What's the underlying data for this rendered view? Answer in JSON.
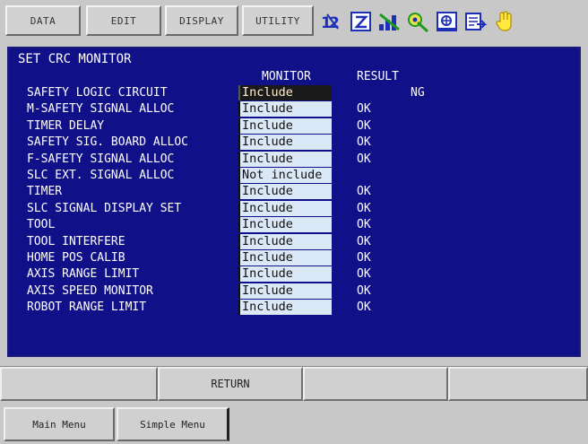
{
  "menubar": {
    "items": [
      "DATA",
      "EDIT",
      "DISPLAY",
      "UTILITY"
    ]
  },
  "icons": [
    "toggle-12-icon",
    "z-icon",
    "signal-icon",
    "tool-icon",
    "monitor-icon",
    "document-arrow-icon",
    "hand-icon"
  ],
  "panel": {
    "title": "SET CRC MONITOR",
    "col_monitor": "MONITOR",
    "col_result": "RESULT",
    "rows": [
      {
        "label": "SAFETY LOGIC CIRCUIT",
        "monitor": "Include",
        "result": "NG",
        "selected": true
      },
      {
        "label": "M-SAFETY SIGNAL ALLOC",
        "monitor": "Include",
        "result": "OK"
      },
      {
        "label": "TIMER DELAY",
        "monitor": "Include",
        "result": "OK"
      },
      {
        "label": "SAFETY SIG. BOARD ALLOC",
        "monitor": "Include",
        "result": "OK"
      },
      {
        "label": "F-SAFETY SIGNAL ALLOC",
        "monitor": "Include",
        "result": "OK"
      },
      {
        "label": "SLC EXT. SIGNAL ALLOC",
        "monitor": "Not include",
        "result": ""
      },
      {
        "label": "TIMER",
        "monitor": "Include",
        "result": "OK"
      },
      {
        "label": "SLC SIGNAL DISPLAY SET",
        "monitor": "Include",
        "result": "OK"
      },
      {
        "label": "TOOL",
        "monitor": "Include",
        "result": "OK"
      },
      {
        "label": "TOOL INTERFERE",
        "monitor": "Include",
        "result": "OK"
      },
      {
        "label": "HOME POS CALIB",
        "monitor": "Include",
        "result": "OK"
      },
      {
        "label": "AXIS RANGE LIMIT",
        "monitor": "Include",
        "result": "OK"
      },
      {
        "label": "AXIS SPEED MONITOR",
        "monitor": "Include",
        "result": "OK"
      },
      {
        "label": "ROBOT RANGE LIMIT",
        "monitor": "Include",
        "result": "OK"
      }
    ]
  },
  "function_keys": {
    "return_label": "RETURN"
  },
  "bottom": {
    "main_menu": "Main Menu",
    "simple_menu": "Simple Menu"
  },
  "colors": {
    "panel_bg": "#101088",
    "field_bg": "#dbe8f8",
    "chrome": "#c8c8c8"
  }
}
